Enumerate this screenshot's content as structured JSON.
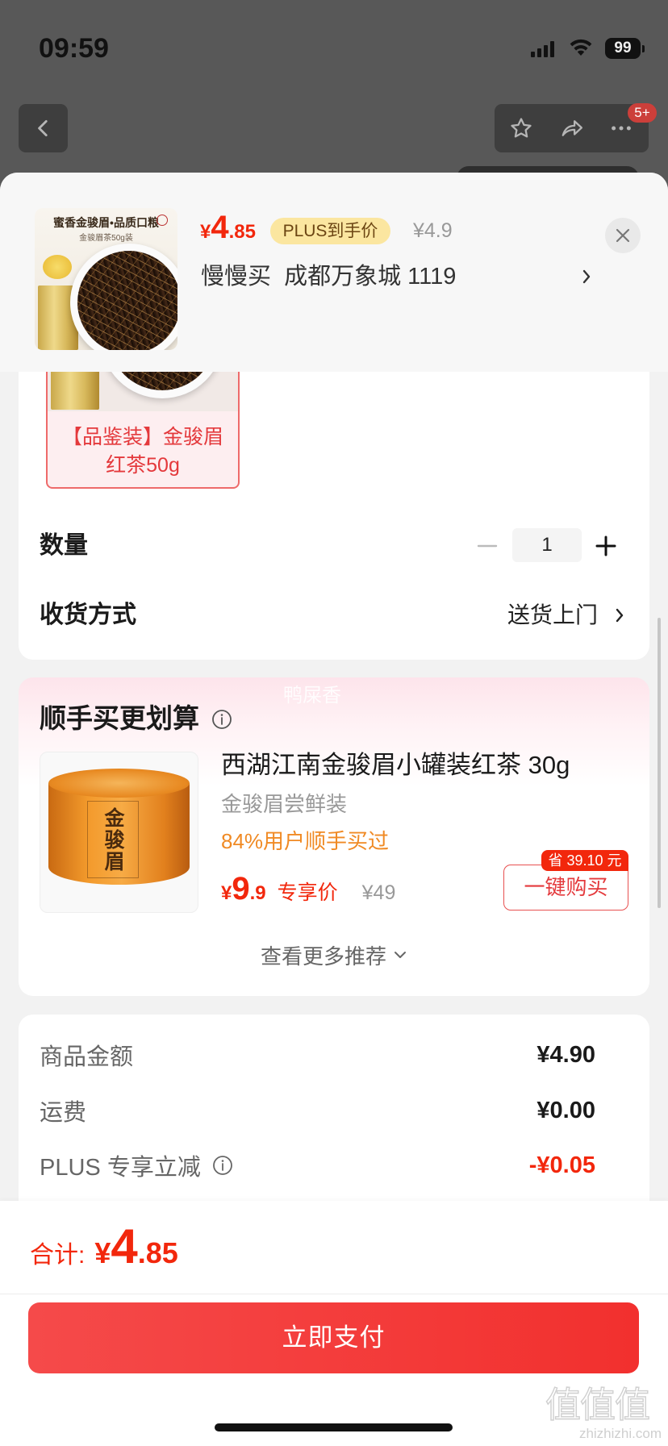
{
  "status_bar": {
    "time": "09:59",
    "battery": "99",
    "icons": [
      "signal-icon",
      "wifi-icon",
      "battery-icon"
    ]
  },
  "nav": {
    "badge": "5+",
    "icons": [
      "back-icon",
      "star-icon",
      "share-icon",
      "more-icon"
    ]
  },
  "sheet_header": {
    "thumb_title": "蜜香金骏眉•品质口粮",
    "thumb_subtitle": "金骏眉茶50g装",
    "price_symbol": "¥",
    "price_int": "4",
    "price_dec": ".85",
    "plus_label": "PLUS到手价",
    "original_price": "¥4.9",
    "location": "慢慢买  成都万象城 1119",
    "icons": [
      "chevron-right-icon",
      "close-icon"
    ]
  },
  "spec": {
    "line1": "【品鉴装】金骏眉",
    "line2": "红茶50g"
  },
  "quantity": {
    "label": "数量",
    "value": "1",
    "icons": [
      "minus-icon",
      "plus-icon"
    ]
  },
  "delivery": {
    "label": "收货方式",
    "value": "送货上门",
    "icon": "chevron-right-icon"
  },
  "addon": {
    "ghost_text": "鸭屎香",
    "title": "顺手买更划算",
    "can_label": "金骏眉",
    "product_name": "西湖江南金骏眉小罐装红茶 30g",
    "product_sub": "金骏眉尝鲜装",
    "social_proof": "84%用户顺手买过",
    "price_symbol": "¥",
    "price_int": "9",
    "price_dec": ".9",
    "price_label": "专享价",
    "original_price": "¥49",
    "save_badge": "省 39.10 元",
    "buy_label": "一键购买",
    "more_label": "查看更多推荐",
    "icons": [
      "info-icon",
      "chevron-down-icon"
    ]
  },
  "summary": {
    "rows": [
      {
        "label": "商品金额",
        "value": "¥4.90"
      },
      {
        "label": "运费",
        "value": "¥0.00"
      },
      {
        "label": "PLUS 专享立减",
        "value": "-¥0.05"
      }
    ]
  },
  "footer": {
    "total_label": "合计:",
    "total_symbol": "¥",
    "total_int": "4",
    "total_dec": ".85",
    "pay_label": "立即支付"
  },
  "watermark": {
    "logo": "值值值",
    "site": "zhizhizhi.com"
  },
  "colors": {
    "red": "#f2270c",
    "accent_red": "#e4393c",
    "orange": "#f08a24",
    "plus_bg": "#fbe6a0",
    "plus_text": "#6b4412",
    "overlay": "#585858",
    "page_bg": "#f2f2f2",
    "pay_start": "#f54a4a",
    "pay_end": "#f2302e"
  }
}
